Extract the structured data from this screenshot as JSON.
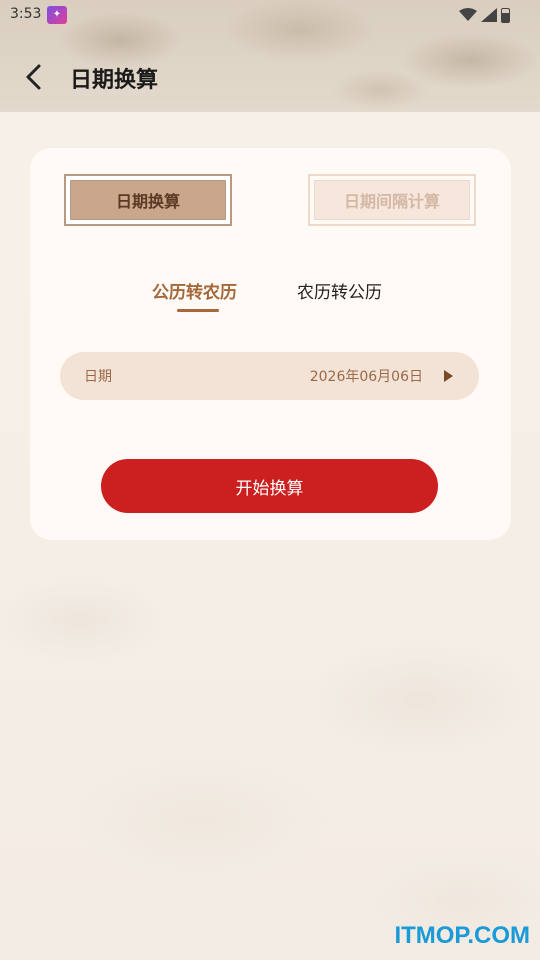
{
  "status_bar": {
    "time": "3:53",
    "app_icon": "notification-app-icon",
    "icons": [
      "wifi-icon",
      "signal-icon",
      "battery-icon"
    ]
  },
  "header": {
    "title": "日期换算",
    "back_icon": "chevron-left-icon"
  },
  "mode_tabs": [
    {
      "label": "日期换算",
      "active": true
    },
    {
      "label": "日期间隔计算",
      "active": false
    }
  ],
  "sub_tabs": [
    {
      "label": "公历转农历",
      "active": true
    },
    {
      "label": "农历转公历",
      "active": false
    }
  ],
  "date_field": {
    "label": "日期",
    "value": "2026年06月06日",
    "icon": "play-arrow-icon"
  },
  "start_button": {
    "label": "开始换算"
  },
  "watermark": "ITMOP.COM",
  "colors": {
    "accent_red": "#cc1f1f",
    "accent_brown": "#a5683a",
    "card_bg": "#fffaf6",
    "field_bg": "#f3e3d6"
  }
}
